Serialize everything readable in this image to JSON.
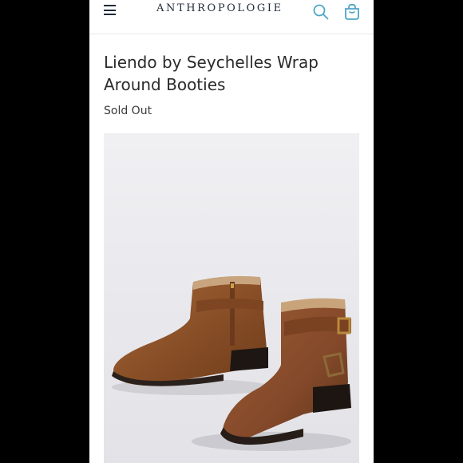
{
  "header": {
    "brand": "ANTHROPOLOGIE",
    "icons": {
      "menu": "menu-icon",
      "search": "search-icon",
      "bag": "shopping-bag-icon"
    },
    "accent_color": "#4ea6c6"
  },
  "product": {
    "title": "Liendo by Seychelles Wrap Around Booties",
    "status": "Sold Out",
    "image": "brown-leather-ankle-booties-image"
  }
}
